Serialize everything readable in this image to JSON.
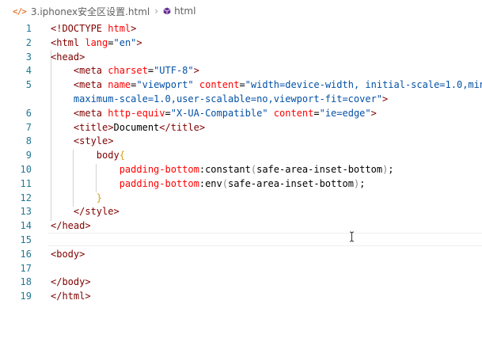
{
  "breadcrumb": {
    "file_icon": "html-file-icon",
    "filename": "3.iphonex安全区设置.html",
    "separator": "›",
    "symbol_icon": "cube-symbol-icon",
    "symbol": "html"
  },
  "lines": [
    {
      "num": "1",
      "segments": [
        {
          "t": "<!DOCTYPE ",
          "c": "tag"
        },
        {
          "t": "html",
          "c": "attr"
        },
        {
          "t": ">",
          "c": "tag"
        }
      ]
    },
    {
      "num": "2",
      "segments": [
        {
          "t": "<html ",
          "c": "tag"
        },
        {
          "t": "lang",
          "c": "attr"
        },
        {
          "t": "=",
          "c": "txt"
        },
        {
          "t": "\"en\"",
          "c": "str"
        },
        {
          "t": ">",
          "c": "tag"
        }
      ]
    },
    {
      "num": "3",
      "segments": [
        {
          "t": "<head>",
          "c": "tag"
        }
      ]
    },
    {
      "num": "4",
      "segments": [
        {
          "t": "    <meta ",
          "c": "tag"
        },
        {
          "t": "charset",
          "c": "attr"
        },
        {
          "t": "=",
          "c": "txt"
        },
        {
          "t": "\"UTF-8\"",
          "c": "str"
        },
        {
          "t": ">",
          "c": "tag"
        }
      ]
    },
    {
      "num": "5",
      "segments": [
        {
          "t": "    <meta ",
          "c": "tag"
        },
        {
          "t": "name",
          "c": "attr"
        },
        {
          "t": "=",
          "c": "txt"
        },
        {
          "t": "\"viewport\"",
          "c": "str"
        },
        {
          "t": " content",
          "c": "attr"
        },
        {
          "t": "=",
          "c": "txt"
        },
        {
          "t": "\"width=device-width, initial-scale=1.0,min",
          "c": "str"
        }
      ]
    },
    {
      "num": "",
      "segments": [
        {
          "t": "    maximum-scale=1.0,user-scalable=no,viewport-fit=cover\"",
          "c": "str"
        },
        {
          "t": ">",
          "c": "tag"
        }
      ]
    },
    {
      "num": "6",
      "segments": [
        {
          "t": "    <meta ",
          "c": "tag"
        },
        {
          "t": "http-equiv",
          "c": "attr"
        },
        {
          "t": "=",
          "c": "txt"
        },
        {
          "t": "\"X-UA-Compatible\"",
          "c": "str"
        },
        {
          "t": " content",
          "c": "attr"
        },
        {
          "t": "=",
          "c": "txt"
        },
        {
          "t": "\"ie=edge\"",
          "c": "str"
        },
        {
          "t": ">",
          "c": "tag"
        }
      ]
    },
    {
      "num": "7",
      "segments": [
        {
          "t": "    <title>",
          "c": "tag"
        },
        {
          "t": "Document",
          "c": "txt"
        },
        {
          "t": "</title>",
          "c": "tag"
        }
      ]
    },
    {
      "num": "8",
      "segments": [
        {
          "t": "    <style>",
          "c": "tag"
        }
      ]
    },
    {
      "num": "9",
      "segments": [
        {
          "t": "        body",
          "c": "sel"
        },
        {
          "t": "{",
          "c": "brace"
        }
      ]
    },
    {
      "num": "10",
      "segments": [
        {
          "t": "            padding-bottom",
          "c": "prop"
        },
        {
          "t": ":constant",
          "c": "txt"
        },
        {
          "t": "(",
          "c": "paren"
        },
        {
          "t": "safe-area-inset-bottom",
          "c": "txt"
        },
        {
          "t": ")",
          "c": "paren"
        },
        {
          "t": ";",
          "c": "txt"
        }
      ]
    },
    {
      "num": "11",
      "segments": [
        {
          "t": "            padding-bottom",
          "c": "prop"
        },
        {
          "t": ":env",
          "c": "txt"
        },
        {
          "t": "(",
          "c": "paren"
        },
        {
          "t": "safe-area-inset-bottom",
          "c": "txt"
        },
        {
          "t": ")",
          "c": "paren"
        },
        {
          "t": ";",
          "c": "txt"
        }
      ]
    },
    {
      "num": "12",
      "segments": [
        {
          "t": "        }",
          "c": "brace"
        }
      ]
    },
    {
      "num": "13",
      "segments": [
        {
          "t": "    </style>",
          "c": "tag"
        }
      ]
    },
    {
      "num": "14",
      "segments": [
        {
          "t": "</head>",
          "c": "tag"
        }
      ]
    },
    {
      "num": "15",
      "segments": []
    },
    {
      "num": "16",
      "segments": [
        {
          "t": "<body>",
          "c": "tag"
        }
      ]
    },
    {
      "num": "17",
      "segments": []
    },
    {
      "num": "18",
      "segments": [
        {
          "t": "</body>",
          "c": "tag"
        }
      ]
    },
    {
      "num": "19",
      "segments": [
        {
          "t": "</html>",
          "c": "tag"
        }
      ]
    }
  ],
  "cursor_icon": "text-cursor-icon",
  "colors": {
    "tag": "#800000",
    "attribute": "#ff0000",
    "string": "#0451a5",
    "property": "#ff0000",
    "brace": "#d5a21a",
    "line_number": "#237893",
    "file_icon": "#e37933"
  }
}
